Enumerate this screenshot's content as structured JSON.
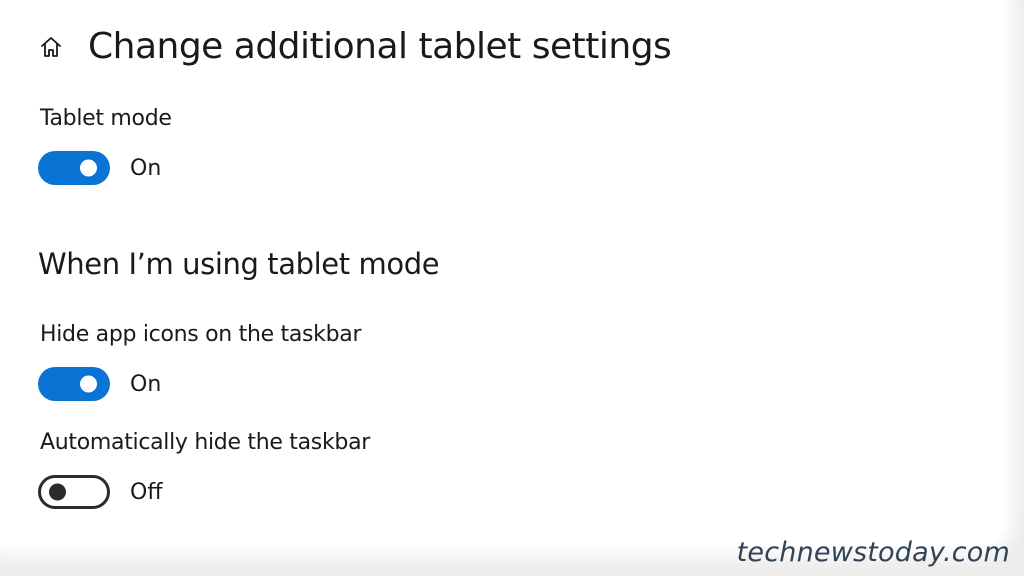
{
  "header": {
    "home_icon": "home-icon",
    "title": "Change additional tablet settings"
  },
  "tablet_mode": {
    "label": "Tablet mode",
    "state": "On",
    "enabled": true
  },
  "section": {
    "heading": "When I’m using tablet mode"
  },
  "hide_app_icons": {
    "label": "Hide app icons on the taskbar",
    "state": "On",
    "enabled": true
  },
  "auto_hide_taskbar": {
    "label": "Automatically hide the taskbar",
    "state": "Off",
    "enabled": false
  },
  "colors": {
    "accent": "#0a74d4",
    "toggle_off": "#2b2b2b"
  },
  "watermark": "technewstoday.com"
}
